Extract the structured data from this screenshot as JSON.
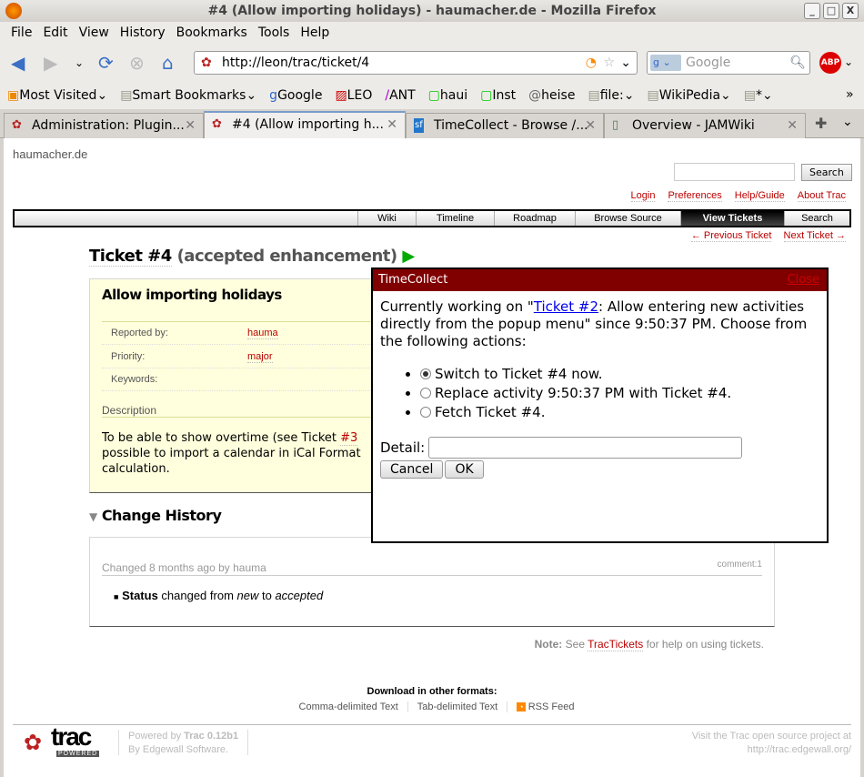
{
  "window": {
    "title": "#4 (Allow importing holidays) - haumacher.de - Mozilla Firefox"
  },
  "menu": [
    "File",
    "Edit",
    "View",
    "History",
    "Bookmarks",
    "Tools",
    "Help"
  ],
  "toolbar": {
    "url": "http://leon/trac/ticket/4",
    "search_placeholder": "Google"
  },
  "bookmarks": [
    "Most Visited",
    "Smart Bookmarks",
    "Google",
    "LEO",
    "ANT",
    "haui",
    "Inst",
    "heise",
    "file:",
    "WikiPedia",
    "*"
  ],
  "tabs": [
    {
      "label": "Administration: Plugin...",
      "active": false
    },
    {
      "label": "#4 (Allow importing h...",
      "active": true
    },
    {
      "label": "TimeCollect - Browse /...",
      "active": false
    },
    {
      "label": "Overview - JAMWiki",
      "active": false
    }
  ],
  "site": {
    "name": "haumacher.de",
    "search_button": "Search",
    "metanav": [
      "Login",
      "Preferences",
      "Help/Guide",
      "About Trac"
    ],
    "mainnav": [
      "Wiki",
      "Timeline",
      "Roadmap",
      "Browse Source",
      "View Tickets",
      "Search"
    ],
    "prev": "← Previous Ticket",
    "next": "Next Ticket →"
  },
  "ticket": {
    "id": "Ticket #4",
    "status": "(accepted enhancement)",
    "summary": "Allow importing holidays",
    "reported_by_label": "Reported by:",
    "reported_by": "hauma",
    "priority_label": "Priority:",
    "priority": "major",
    "keywords_label": "Keywords:",
    "description_label": "Description",
    "description_1": "To be able to show overtime (see Ticket ",
    "description_link": "#3",
    "description_2": "possible to import a calendar in iCal Format",
    "description_3": "calculation."
  },
  "history": {
    "title": "Change History",
    "changed": "Changed 8 months ago by hauma",
    "comment": "comment:1",
    "field": "Status",
    "text1": " changed from ",
    "from": "new",
    "text2": " to ",
    "to": "accepted"
  },
  "note": {
    "label": "Note:",
    "pre": " See ",
    "link": "TracTickets",
    "post": " for help on using tickets."
  },
  "download": {
    "title": "Download in other formats:",
    "links": [
      "Comma-delimited Text",
      "Tab-delimited Text",
      "RSS Feed"
    ]
  },
  "footer": {
    "powered": "Powered by ",
    "trac_version": "Trac 0.12b1",
    "by": "By ",
    "edgewall": "Edgewall Software.",
    "visit": "Visit the Trac open source project at",
    "url": "http://trac.edgewall.org/"
  },
  "popup": {
    "title": "TimeCollect",
    "close": "Close",
    "text_pre": "Currently working on \"",
    "link": "Ticket #2",
    "text_post": ": Allow entering new activities directly from the popup menu\" since 9:50:37 PM. Choose from the following actions:",
    "options": [
      "Switch to Ticket #4 now.",
      "Replace activity 9:50:37 PM with Ticket #4.",
      "Fetch Ticket #4."
    ],
    "detail_label": "Detail:",
    "detail_value": "",
    "cancel": "Cancel",
    "ok": "OK"
  },
  "colors": {
    "popup_header": "#800000",
    "link": "#bb0000",
    "ticket_bg": "#ffffdd"
  }
}
